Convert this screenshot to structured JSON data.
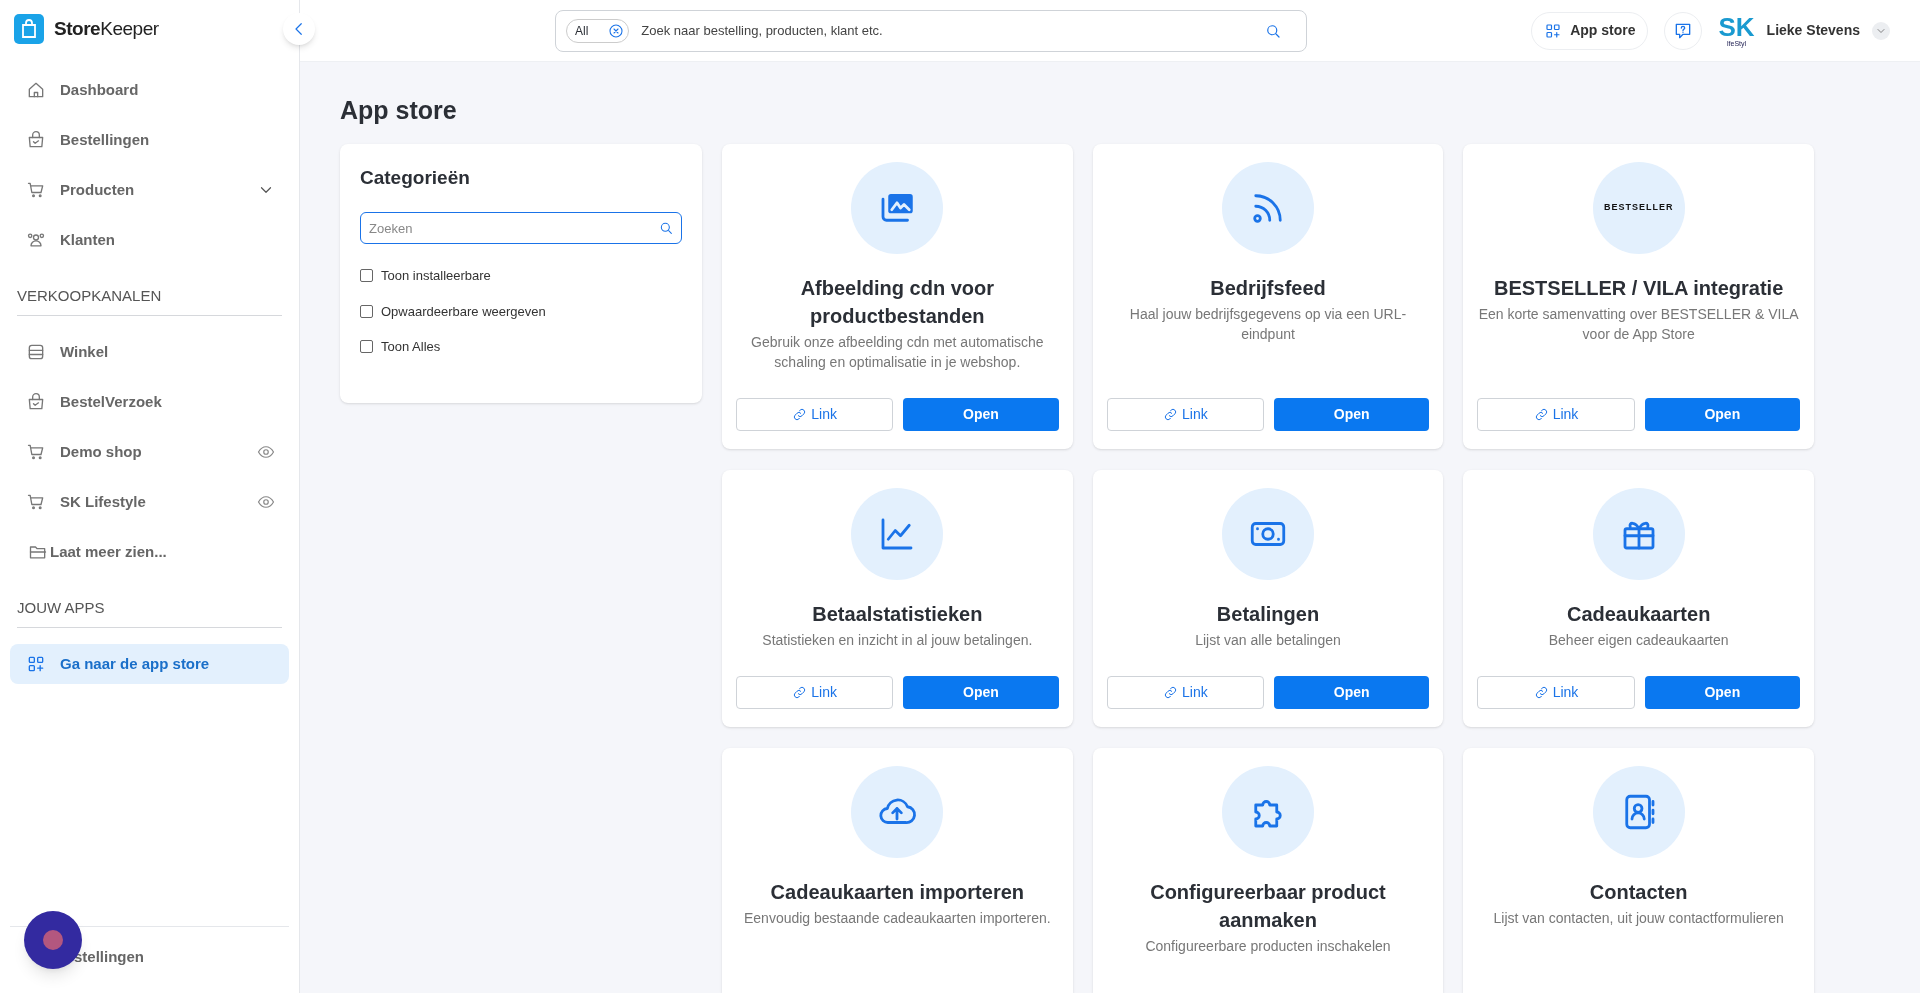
{
  "brand": {
    "name_bold": "Store",
    "name_light": "Keeper"
  },
  "sidebar": {
    "sections": [
      {
        "items": [
          {
            "label": "Dashboard",
            "selected": false
          },
          {
            "label": "Bestellingen",
            "selected": false
          },
          {
            "label": "Producten",
            "selected": false,
            "expanded": false
          },
          {
            "label": "Klanten",
            "selected": false
          }
        ]
      },
      {
        "title": "VERKOOPKANALEN",
        "items": [
          {
            "label": "Winkel",
            "selected": false
          },
          {
            "label": "BestelVerzoek",
            "selected": false
          },
          {
            "label": "Demo shop",
            "selected": false,
            "preview": true
          },
          {
            "label": "SK Lifestyle",
            "selected": false,
            "preview": true
          },
          {
            "label": "Laat meer zien...",
            "selected": false
          }
        ]
      },
      {
        "title": "JOUW APPS",
        "items": [
          {
            "label": "Ga naar de app store",
            "selected": true
          }
        ]
      }
    ],
    "footer_item": "stellingen"
  },
  "search": {
    "scope": "All",
    "placeholder": "Zoek naar bestelling, producten, klant etc."
  },
  "header": {
    "app_store_button": "App store",
    "logo_letters": "SK",
    "logo_sub": "lfeStyl",
    "user": "Lieke Stevens"
  },
  "page_title": "App store",
  "categories": {
    "title": "Categorieën",
    "search_placeholder": "Zoeken",
    "filters": [
      {
        "label": "Toon installeerbare",
        "checked": false
      },
      {
        "label": "Opwaardeerbare weergeven",
        "checked": false
      },
      {
        "label": "Toon Alles",
        "checked": false
      }
    ]
  },
  "apps": [
    {
      "title": "Afbeelding cdn voor productbestanden",
      "description": "Gebruik onze afbeelding cdn met automatische schaling en optimalisatie in je webshop.",
      "link": "Link",
      "open": "Open"
    },
    {
      "title": "Bedrijfsfeed",
      "description": "Haal jouw bedrijfsgegevens op via een URL-eindpunt",
      "link": "Link",
      "open": "Open"
    },
    {
      "title": "BESTSELLER / VILA integratie",
      "description": "Een korte samenvatting over BESTSELLER & VILA voor de App Store",
      "logo_text": "BESTSELLER",
      "link": "Link",
      "open": "Open"
    },
    {
      "title": "Betaalstatistieken",
      "description": "Statistieken en inzicht in al jouw betalingen.",
      "link": "Link",
      "open": "Open"
    },
    {
      "title": "Betalingen",
      "description": "Lijst van alle betalingen",
      "link": "Link",
      "open": "Open"
    },
    {
      "title": "Cadeaukaarten",
      "description": "Beheer eigen cadeaukaarten",
      "link": "Link",
      "open": "Open"
    },
    {
      "title": "Cadeaukaarten importeren",
      "description": "Eenvoudig bestaande cadeaukaarten importeren."
    },
    {
      "title": "Configureerbaar product aanmaken",
      "description": "Configureerbare producten inschakelen"
    },
    {
      "title": "Contacten",
      "description": "Lijst van contacten, uit jouw contactformulieren"
    }
  ]
}
